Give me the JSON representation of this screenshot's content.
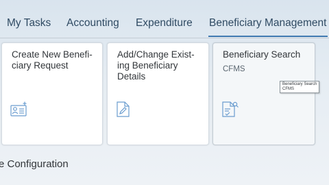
{
  "tabs": [
    {
      "label": "My Tasks"
    },
    {
      "label": "Accounting"
    },
    {
      "label": "Expenditure"
    },
    {
      "label": "Beneficiary Management"
    }
  ],
  "tiles": [
    {
      "title": "Create New Benefi-ciary Request",
      "subtitle": "",
      "icon": "beneficiary-card-icon"
    },
    {
      "title": "Add/Change Exist-ing Beneficiary Details",
      "subtitle": "",
      "icon": "edit-document-icon"
    },
    {
      "title": "Beneficiary Search",
      "subtitle": "CFMS",
      "icon": "document-search-icon"
    }
  ],
  "tooltip": {
    "line1": "Beneficiary Search",
    "line2": "CFMS"
  },
  "section": {
    "title": "e Configuration"
  },
  "colors": {
    "accent": "#3f79b0",
    "icon": "#6a9ccf"
  }
}
